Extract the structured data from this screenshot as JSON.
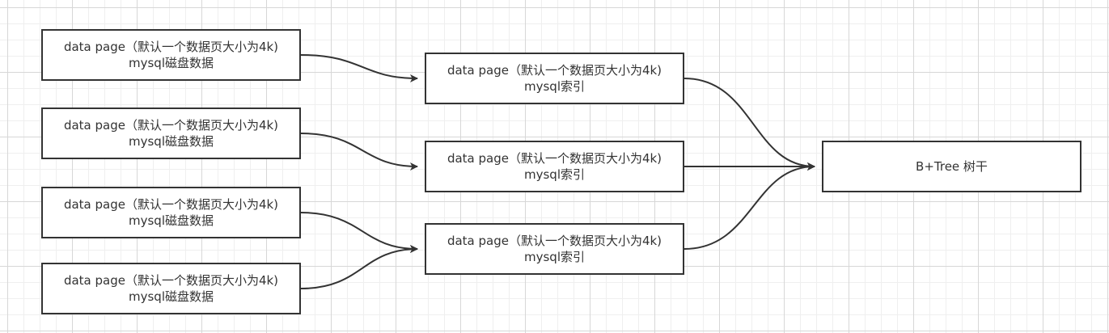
{
  "diagram": {
    "source_nodes": [
      {
        "line1": "data page（默认一个数据页大小为4k)",
        "line2": "mysql磁盘数据"
      },
      {
        "line1": "data page（默认一个数据页大小为4k)",
        "line2": "mysql磁盘数据"
      },
      {
        "line1": "data page（默认一个数据页大小为4k)",
        "line2": "mysql磁盘数据"
      },
      {
        "line1": "data page（默认一个数据页大小为4k)",
        "line2": "mysql磁盘数据"
      }
    ],
    "index_nodes": [
      {
        "line1": "data page（默认一个数据页大小为4k)",
        "line2": "mysql索引"
      },
      {
        "line1": "data page（默认一个数据页大小为4k)",
        "line2": "mysql索引"
      },
      {
        "line1": "data page（默认一个数据页大小为4k)",
        "line2": "mysql索引"
      }
    ],
    "root_node": {
      "label": "B+Tree 树干"
    },
    "connections": [
      {
        "from": "source-node-1",
        "to": "index-node-1"
      },
      {
        "from": "source-node-2",
        "to": "index-node-2"
      },
      {
        "from": "source-node-3",
        "to": "index-node-3"
      },
      {
        "from": "source-node-4",
        "to": "index-node-3"
      },
      {
        "from": "index-node-1",
        "to": "root-node"
      },
      {
        "from": "index-node-2",
        "to": "root-node"
      },
      {
        "from": "index-node-3",
        "to": "root-node"
      }
    ],
    "colors": {
      "stroke": "#333333",
      "node_fill": "#ffffff",
      "grid_major": "#d7d7d7",
      "grid_minor": "#efefef"
    }
  }
}
